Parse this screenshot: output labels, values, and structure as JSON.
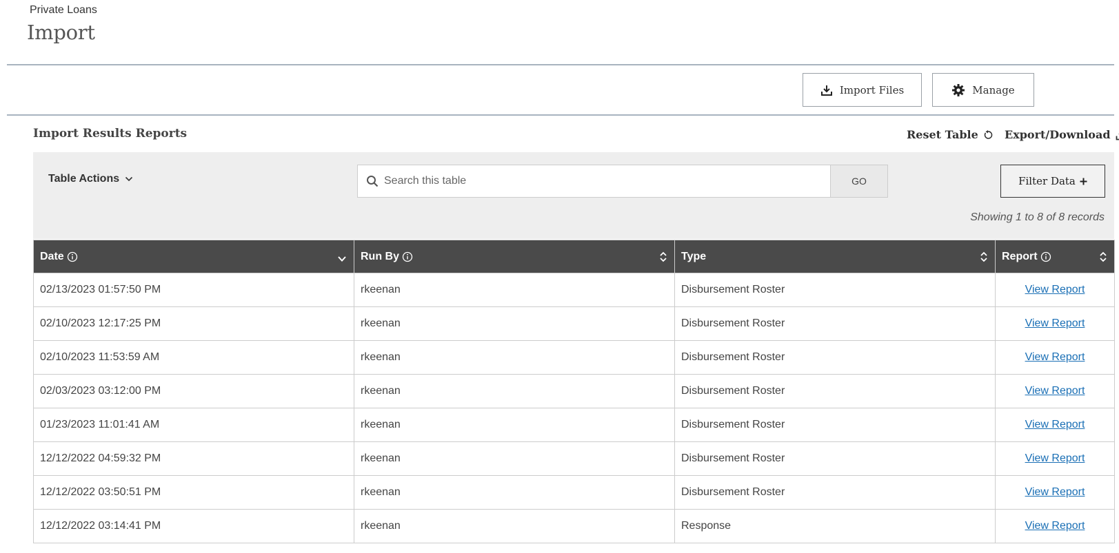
{
  "header": {
    "breadcrumb": "Private Loans",
    "title": "Import"
  },
  "toolbar": {
    "import_label": "Import Files",
    "manage_label": "Manage"
  },
  "section": {
    "title": "Import Results Reports",
    "reset_label": "Reset Table",
    "export_label": "Export/Download"
  },
  "controls": {
    "table_actions_label": "Table Actions",
    "search_placeholder": "Search this table",
    "go_label": "GO",
    "filter_label": "Filter Data",
    "records_text": "Showing 1 to 8 of 8 records"
  },
  "table": {
    "columns": [
      "Date",
      "Run By",
      "Type",
      "Report"
    ],
    "rows": [
      {
        "date": "02/13/2023 01:57:50 PM",
        "run_by": "rkeenan",
        "type": "Disbursement Roster",
        "report": "View Report"
      },
      {
        "date": "02/10/2023 12:17:25 PM",
        "run_by": "rkeenan",
        "type": "Disbursement Roster",
        "report": "View Report"
      },
      {
        "date": "02/10/2023 11:53:59 AM",
        "run_by": "rkeenan",
        "type": "Disbursement Roster",
        "report": "View Report"
      },
      {
        "date": "02/03/2023 03:12:00 PM",
        "run_by": "rkeenan",
        "type": "Disbursement Roster",
        "report": "View Report"
      },
      {
        "date": "01/23/2023 11:01:41 AM",
        "run_by": "rkeenan",
        "type": "Disbursement Roster",
        "report": "View Report"
      },
      {
        "date": "12/12/2022 04:59:32 PM",
        "run_by": "rkeenan",
        "type": "Disbursement Roster",
        "report": "View Report"
      },
      {
        "date": "12/12/2022 03:50:51 PM",
        "run_by": "rkeenan",
        "type": "Disbursement Roster",
        "report": "View Report"
      },
      {
        "date": "12/12/2022 03:14:41 PM",
        "run_by": "rkeenan",
        "type": "Response",
        "report": "View Report"
      }
    ]
  },
  "colors": {
    "header_bg": "#4a4a4a",
    "link": "#1a6fb5",
    "panel_bg": "#eeeeee",
    "rule": "#a8b3bf"
  },
  "icons": [
    "download-tray-icon",
    "gear-icon",
    "reset-icon",
    "download-icon",
    "chevron-down-icon",
    "search-icon",
    "plus-icon",
    "info-icon",
    "sort-icon"
  ]
}
